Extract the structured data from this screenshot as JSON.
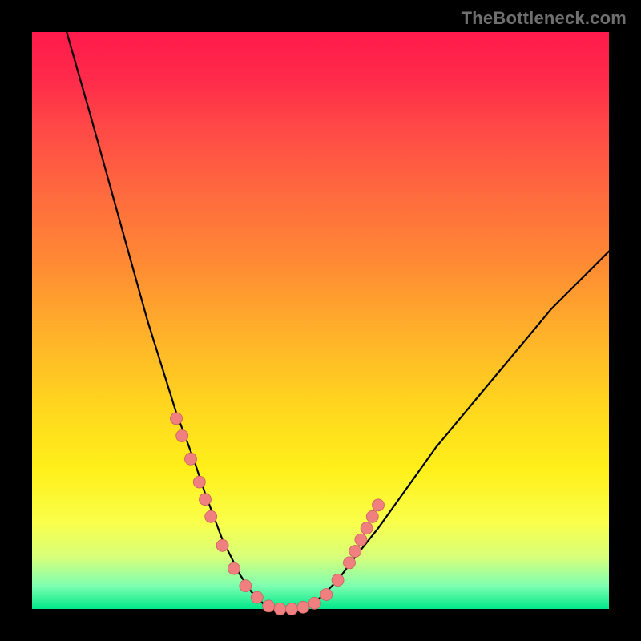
{
  "watermark": "TheBottleneck.com",
  "colors": {
    "background": "#000000",
    "gradient_top": "#ff1a4b",
    "gradient_bottom": "#00e88a",
    "curve": "#000000",
    "dot_fill": "#f08080",
    "dot_stroke": "#c86060"
  },
  "chart_data": {
    "type": "line",
    "title": "",
    "xlabel": "",
    "ylabel": "",
    "xlim": [
      0,
      100
    ],
    "ylim": [
      0,
      100
    ],
    "grid": false,
    "note": "Axes are unlabeled; x treated as 0–100 left→right, y as 0–100 bottom→top (0 ≈ best match / bottom of plot).",
    "series": [
      {
        "name": "bottleneck-curve",
        "x": [
          6,
          10,
          15,
          20,
          25,
          28,
          30,
          33,
          36,
          38,
          40,
          42,
          44,
          46,
          48,
          50,
          53,
          56,
          60,
          65,
          70,
          75,
          80,
          85,
          90,
          95,
          100
        ],
        "y": [
          100,
          86,
          68,
          50,
          34,
          26,
          20,
          12,
          6,
          3,
          1,
          0,
          0,
          0,
          0.5,
          2,
          5,
          9,
          14,
          21,
          28,
          34,
          40,
          46,
          52,
          57,
          62
        ]
      }
    ],
    "markers": {
      "name": "sample-points",
      "x": [
        25,
        26,
        27.5,
        29,
        30,
        31,
        33,
        35,
        37,
        39,
        41,
        43,
        45,
        47,
        49,
        51,
        53,
        55,
        56,
        57,
        58,
        59,
        60
      ],
      "y": [
        33,
        30,
        26,
        22,
        19,
        16,
        11,
        7,
        4,
        2,
        0.5,
        0,
        0,
        0.3,
        1,
        2.5,
        5,
        8,
        10,
        12,
        14,
        16,
        18
      ]
    }
  }
}
